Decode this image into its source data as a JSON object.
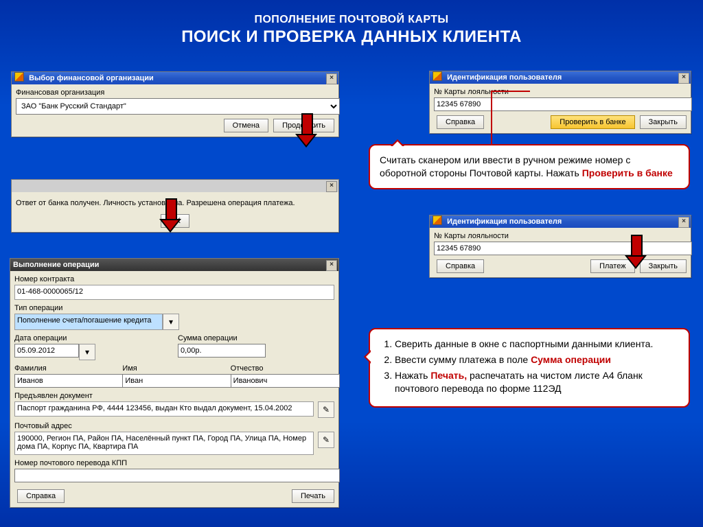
{
  "header": {
    "subtitle": "ПОПОЛНЕНИЕ ПОЧТОВОЙ КАРТЫ",
    "title": "ПОИСК И ПРОВЕРКА ДАННЫХ КЛИЕНТА"
  },
  "dlg_org": {
    "title": "Выбор финансовой организации",
    "label_org": "Финансовая организация",
    "org_value": "ЗАО \"Банк Русский Стандарт\"",
    "btn_cancel": "Отмена",
    "btn_continue": "Продолжить"
  },
  "dlg_bankresp": {
    "message": "Ответ от банка получен. Личность установлена. Разрешена операция платежа.",
    "btn_ok": "OK"
  },
  "dlg_ident": {
    "title": "Идентификация пользователя",
    "label_card": "№ Карты лояльности",
    "card_value": "12345 67890",
    "btn_help": "Справка",
    "btn_check": "Проверить в банке",
    "btn_close": "Закрыть",
    "btn_pay": "Платеж"
  },
  "callout1": {
    "line1": "Считать сканером или ввести в ручном режиме номер с оборотной стороны Почтовой карты. Нажать ",
    "em": "Проверить в банке"
  },
  "callout2": {
    "items": [
      {
        "text": "Сверить данные в окне с паспортными данными  клиента."
      },
      {
        "text_before": "Ввести сумму платежа в поле ",
        "em": "Сумма операции"
      },
      {
        "text_before": "Нажать ",
        "em": "Печать,",
        "text_after": " распечатать на чистом листе А4 бланк почтового перевода по форме  112ЭД"
      }
    ]
  },
  "dlg_oper": {
    "title": "Выполнение операции",
    "lbl_contract": "Номер контракта",
    "val_contract": "01-468-0000065/12",
    "lbl_type": "Тип операции",
    "val_type": "Пополнение счета/погашение кредита",
    "lbl_date": "Дата операции",
    "val_date": "05.09.2012",
    "lbl_sum": "Сумма операции",
    "val_sum": "0,00р.",
    "lbl_lname": "Фамилия",
    "val_lname": "Иванов",
    "lbl_fname": "Имя",
    "val_fname": "Иван",
    "lbl_mname": "Отчество",
    "val_mname": "Иванович",
    "lbl_doc": "Предъявлен документ",
    "val_doc": "Паспорт гражданина РФ, 4444 123456, выдан Кто выдал документ, 15.04.2002",
    "lbl_addr": "Почтовый адрес",
    "val_addr": "190000, Регион ПА, Район ПА, Населённый пункт ПА, Город ПА, Улица ПА, Номер дома ПА, Корпус ПА, Квартира ПА",
    "lbl_kpp": "Номер почтового перевода КПП",
    "val_kpp": "",
    "btn_help": "Справка",
    "btn_print": "Печать"
  },
  "icons": {
    "close": "×",
    "edit": "✎",
    "dropdown": "▾"
  }
}
